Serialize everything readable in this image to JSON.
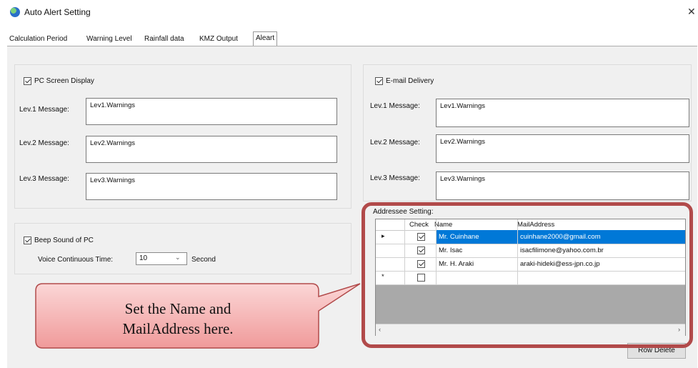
{
  "window": {
    "title": "Auto Alert Setting",
    "close_icon": "close-icon"
  },
  "tabs": [
    {
      "label": "Calculation Period"
    },
    {
      "label": "Warning Level"
    },
    {
      "label": "Rainfall data"
    },
    {
      "label": "KMZ Output"
    },
    {
      "label": "Aleart",
      "active": true
    }
  ],
  "pc_screen": {
    "checkbox_label": "PC Screen Display",
    "checked": true,
    "rows": [
      {
        "label": "Lev.1 Message:",
        "value": "Lev1.Warnings"
      },
      {
        "label": "Lev.2 Message:",
        "value": "Lev2.Warnings"
      },
      {
        "label": "Lev.3 Message:",
        "value": "Lev3.Warnings"
      }
    ]
  },
  "email": {
    "checkbox_label": "E-mail Delivery",
    "checked": true,
    "rows": [
      {
        "label": "Lev.1 Message:",
        "value": "Lev1.Warnings"
      },
      {
        "label": "Lev.2 Message:",
        "value": "Lev2.Warnings"
      },
      {
        "label": "Lev.3 Message:",
        "value": "Lev3.Warnings"
      }
    ]
  },
  "beep": {
    "checkbox_label": "Beep Sound of PC",
    "checked": true,
    "time_label": "Voice Continuous Time:",
    "time_value": "10",
    "unit": "Second"
  },
  "addressee": {
    "title": "Addressee Setting:",
    "columns": {
      "check": "Check",
      "name": "Name",
      "mail": "MailAddress"
    },
    "rows": [
      {
        "checked": true,
        "name": "Mr. Cuinhane",
        "mail": "cuinhane2000@gmail.com",
        "selected": true
      },
      {
        "checked": true,
        "name": "Mr. Isac",
        "mail": "isacfilimone@yahoo.com.br",
        "selected": false
      },
      {
        "checked": true,
        "name": "Mr. H. Araki",
        "mail": "araki-hideki@ess-jpn.co.jp",
        "selected": false
      },
      {
        "checked": false,
        "name": "",
        "mail": "",
        "selected": false
      }
    ],
    "row_delete_button": "Row Delete"
  },
  "callout": {
    "line1": "Set the Name and",
    "line2": "MailAddress here.",
    "fill": "#f4b6b6",
    "border": "#b14a4a"
  },
  "colors": {
    "selection": "#0078d7",
    "highlight_border": "#b14a4a"
  }
}
